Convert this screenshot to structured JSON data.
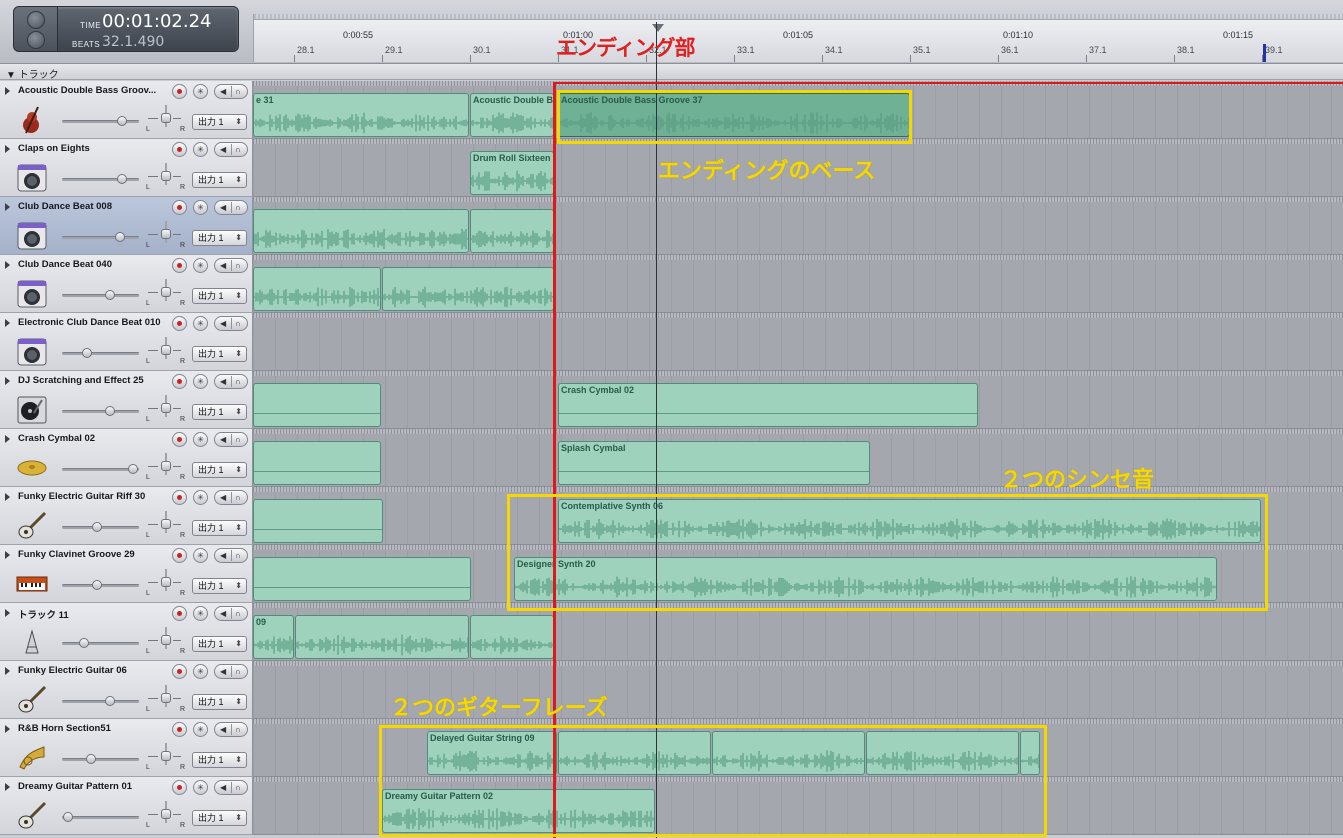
{
  "lcd": {
    "time_label": "TIME",
    "time_value": "00:01:02.24",
    "beats_label": "BEATS",
    "beats_value": "32.1.490"
  },
  "ruler": {
    "times": [
      "0:00:55",
      "0:01:00",
      "0:01:05",
      "0:01:10",
      "0:01:15"
    ],
    "bars": [
      "28.1",
      "29.1",
      "30.1",
      "31.1",
      "32.1",
      "33.1",
      "34.1",
      "35.1",
      "36.1",
      "37.1",
      "38.1",
      "39.1"
    ]
  },
  "track_header_label": "トラック",
  "output_label": "出力 1",
  "pan_left": "L",
  "pan_right": "R",
  "tracks": [
    {
      "name": "Acoustic Double Bass Groov...",
      "icon": "double-bass-icon",
      "volume": 0.78,
      "regions": [
        {
          "name": "e 31",
          "type": "audio"
        },
        {
          "name": "Acoustic Double B",
          "type": "audio"
        },
        {
          "name": "Acoustic Double Bass Groove 37",
          "type": "audio-selected"
        }
      ]
    },
    {
      "name": "Claps on Eights",
      "icon": "drum-machine-icon",
      "volume": 0.78,
      "regions": [
        {
          "name": "Drum Roll Sixteen",
          "type": "audio"
        }
      ]
    },
    {
      "name": "Club Dance Beat 008",
      "icon": "drum-machine-icon",
      "volume": 0.75,
      "selected": true,
      "regions": [
        {
          "name": "",
          "type": "audio"
        },
        {
          "name": "",
          "type": "audio"
        }
      ]
    },
    {
      "name": "Club Dance Beat 040",
      "icon": "drum-machine-icon",
      "volume": 0.62,
      "regions": [
        {
          "name": "",
          "type": "audio"
        },
        {
          "name": "",
          "type": "audio"
        }
      ]
    },
    {
      "name": "Electronic Club Dance Beat 010",
      "icon": "drum-machine-icon",
      "volume": 0.32,
      "regions": []
    },
    {
      "name": "DJ Scratching and Effect 25",
      "icon": "turntable-icon",
      "volume": 0.62,
      "regions": [
        {
          "name": "",
          "type": "flat"
        },
        {
          "name": "Crash Cymbal 02",
          "type": "flat"
        }
      ]
    },
    {
      "name": "Crash Cymbal 02",
      "icon": "cymbal-icon",
      "volume": 0.92,
      "regions": [
        {
          "name": "",
          "type": "flat"
        },
        {
          "name": "Splash Cymbal",
          "type": "flat"
        }
      ]
    },
    {
      "name": "Funky Electric Guitar Riff 30",
      "icon": "electric-guitar-icon",
      "volume": 0.45,
      "regions": [
        {
          "name": "",
          "type": "flat"
        },
        {
          "name": "Contemplative Synth 06",
          "type": "audio"
        }
      ]
    },
    {
      "name": "Funky Clavinet Groove 29",
      "icon": "keyboard-icon",
      "volume": 0.45,
      "regions": [
        {
          "name": "",
          "type": "flat"
        },
        {
          "name": "Designer Synth  20",
          "type": "audio"
        }
      ]
    },
    {
      "name": "トラック 11",
      "icon": "microphone-icon",
      "volume": 0.28,
      "regions": [
        {
          "name": "09",
          "type": "audio"
        },
        {
          "name": "",
          "type": "audio"
        },
        {
          "name": "",
          "type": "audio"
        }
      ]
    },
    {
      "name": "Funky Electric Guitar 06",
      "icon": "electric-guitar-icon",
      "volume": 0.62,
      "regions": []
    },
    {
      "name": "R&B Horn Section51",
      "icon": "horn-icon",
      "volume": 0.38,
      "regions": [
        {
          "name": "Delayed Guitar String 09",
          "type": "audio"
        },
        {
          "name": "",
          "type": "audio"
        },
        {
          "name": "",
          "type": "audio"
        },
        {
          "name": "",
          "type": "audio"
        },
        {
          "name": "",
          "type": "audio"
        }
      ]
    },
    {
      "name": "Dreamy Guitar Pattern 01",
      "icon": "electric-guitar-icon",
      "volume": 0.08,
      "regions": [
        {
          "name": "Dreamy Guitar Pattern 02",
          "type": "audio"
        }
      ]
    }
  ],
  "annotations": {
    "ending": "エンディング部",
    "ending_bass": "エンディングのベース",
    "two_synths": "２つのシンセ音",
    "two_guitars": "２つのギターフレーズ"
  },
  "colors": {
    "region": "#9ed2bc",
    "region_selected": "#6fb195",
    "annotation_red": "#e02020",
    "annotation_yellow": "#f6d800"
  }
}
